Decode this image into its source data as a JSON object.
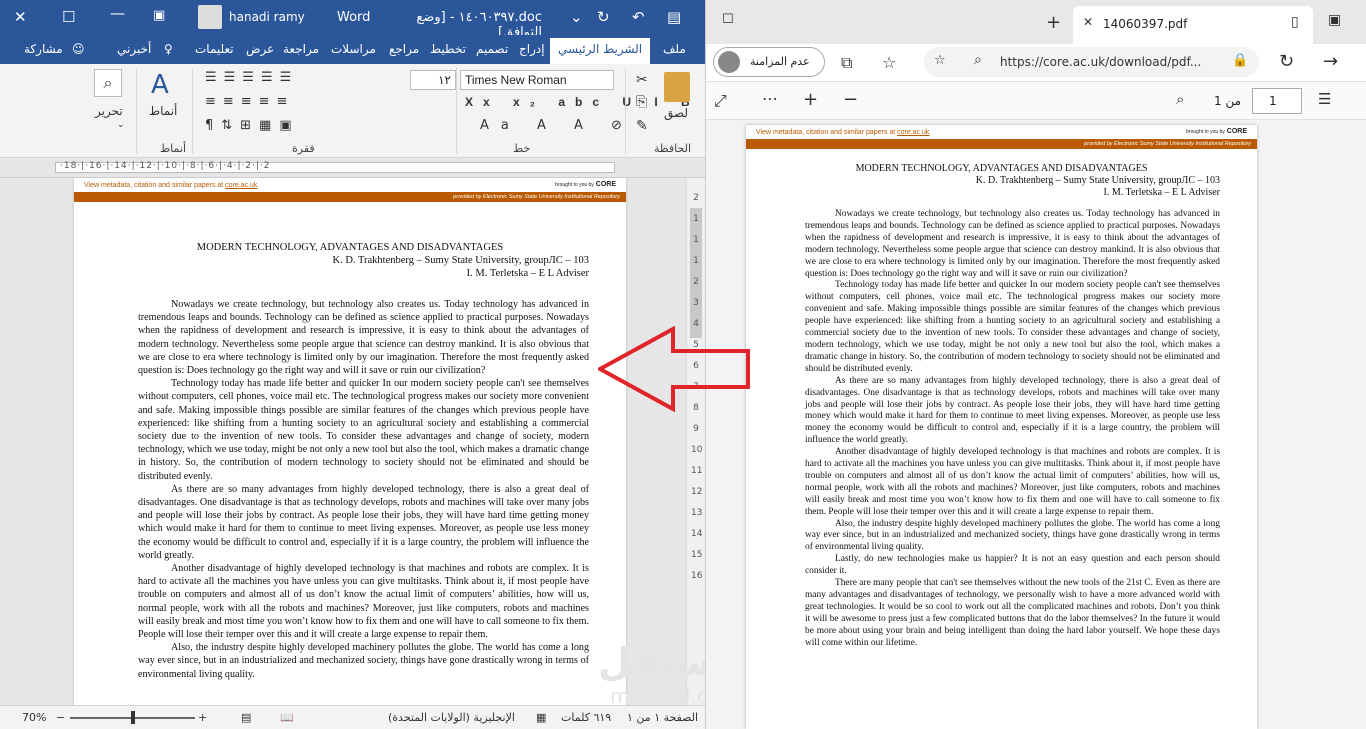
{
  "word": {
    "title": "doc.١٤٠٦٠٣٩٧ - [وضع التوافق]",
    "app": "Word",
    "user": "hanadi ramy",
    "tabs": [
      "ملف",
      "الشريط الرئيسي",
      "إدراج",
      "تصميم",
      "تخطيط",
      "مراجع",
      "مراسلات",
      "مراجعة",
      "عرض",
      "تعليمات",
      "أخبرني"
    ],
    "share": "مشاركة",
    "ribbon": {
      "paste": "لصق",
      "clipboard": "الحافظة",
      "font_name": "Times New Roman",
      "font_size": "١٢",
      "font_group": "خط",
      "paragraph_group": "فقرة",
      "styles": "أنماط",
      "styles_group": "أنماط",
      "edit": "تحرير"
    },
    "ruler_text": "·18·|·16·|·14·|·12·|·10·|·8·|·6·|·4·|·2·|·2",
    "vruler": [
      "2",
      "1",
      "1",
      "1",
      "2",
      "3",
      "4",
      "5",
      "6",
      "7",
      "8",
      "9",
      "10",
      "11",
      "12",
      "13",
      "14",
      "15",
      "16"
    ],
    "document": {
      "core_link_prefix": "View metadata, citation and similar papers at ",
      "core_link": "core.ac.uk",
      "brought": "brought to you by",
      "core": "CORE",
      "provided": "provided by Electronic Sumy State University Institutional Repository",
      "title": "MODERN TECHNOLOGY, ADVANTAGES AND DISADVANTAGES",
      "author1": "K. D. Trakhtenberg – Sumy State University, groupЛС – 103",
      "author2": "I. M. Terletska – E L Adviser",
      "p1": "Nowadays we create technology, but technology also creates us. Today technology has advanced in tremendous leaps and bounds. Technology can be defined as science applied to practical purposes. Nowadays when the rapidness of development and research is impressive, it is easy to think about the advantages of modern technology. Nevertheless some people argue that science can destroy mankind. It is also obvious that we are close to era where technology is limited only by our imagination. Therefore the most frequently asked question is: Does technology go the right way and will it save or ruin our civilization?",
      "p2": "Technology today has made life better and quicker In our modern society people can't see themselves without computers, cell phones, voice mail etc. The technological progress makes our society more convenient and safe. Making impossible things possible are similar features of the changes which previous people have experienced: like shifting from a hunting society to an agricultural society and establishing a commercial society due to the invention of new tools. To consider these advantages and change of society, modern technology, which we use today, might be not only a new tool but also the tool, which makes a dramatic change in history. So, the contribution of modern technology to society should not be eliminated and should be distributed evenly.",
      "p3": "As there are so many advantages from highly developed technology, there is also a great deal of disadvantages. One disadvantage is that as technology develops, robots and machines will take over many jobs and people will lose their jobs by contract. As people lose their jobs, they will have hard time getting money which would make it hard for them to continue to meet living expenses. Moreover, as people use less money the economy would be difficult to control and, especially if it is a large country, the problem will influence the world greatly.",
      "p4": "Another disadvantage of highly developed technology is that machines and robots are complex. It is hard to activate all the machines you have unless you can give multitasks. Think about it, if most people have trouble on computers and almost all of us don’t know the actual limit of computers’ abilities, how will us, normal people, work with all the robots and machines? Moreover, just like computers, robots and machines will easily break and most time you won’t know how to fix them and one will have to call someone to fix them. People will lose their temper over this and it will create a large expense to repair them.",
      "p5": "Also, the industry despite highly developed machinery pollutes the globe. The world has come a long way ever since, but in an industrialized and mechanized society, things have gone drastically wrong in terms of environmental living quality.",
      "p6": "Lastly, do new technologies make us happier? It is not an easy question and each person should consider it.",
      "p7": "There are many people that can't see themselves without the new tools of the 21st C. Even as there are many advantages and disadvantages of technology, we personally wish to have a more advanced world with great technologies. It would be so cool to work out all the complicated machines and robots. Don’t you think it will be awesome to press just a few complicated buttons that do the labor themselves? In the future it would be more about using your brain and being intelligent than doing the hard labor yourself. We hope these days will come within our lifetime."
    },
    "status": {
      "page": "الصفحة ١ من ١",
      "words": "٦١٩ كلمات",
      "lang": "الإنجليزية (الولايات المتحدة)",
      "zoom": "70%",
      "zoom_fraction": 0.5
    }
  },
  "edge": {
    "tab_title": "14060397.pdf",
    "sync": "عدم المزامنة",
    "url": "https://core.ac.uk/download/pdf...",
    "page_num": "1",
    "page_of": "من 1"
  },
  "watermark": {
    "main": "مستقل",
    "sub": "mostaql.com"
  },
  "colors": {
    "word_blue": "#2b579a",
    "core_orange": "#b95a00",
    "arrow_red": "#e0242a"
  }
}
